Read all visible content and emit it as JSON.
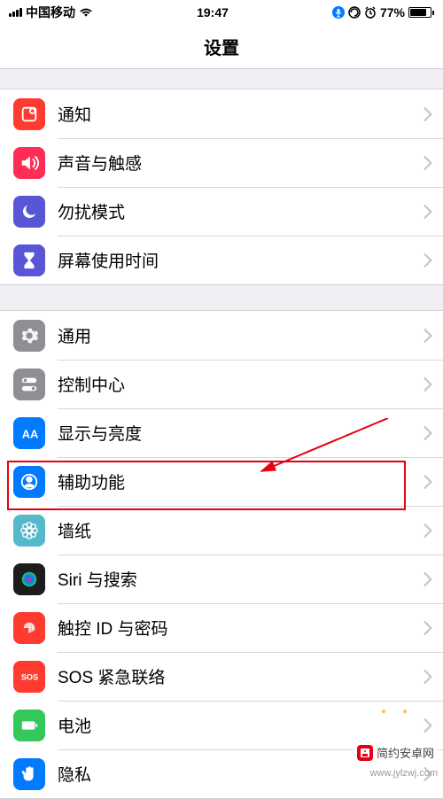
{
  "status": {
    "carrier": "中国移动",
    "time": "19:47",
    "battery_pct": "77%"
  },
  "nav": {
    "title": "设置"
  },
  "group1": [
    {
      "id": "notifications",
      "label": "通知",
      "icon_color": "#ff3b30",
      "icon": "bell"
    },
    {
      "id": "sounds",
      "label": "声音与触感",
      "icon_color": "#ff2d55",
      "icon": "speaker"
    },
    {
      "id": "dnd",
      "label": "勿扰模式",
      "icon_color": "#5856d6",
      "icon": "moon"
    },
    {
      "id": "screentime",
      "label": "屏幕使用时间",
      "icon_color": "#5856d6",
      "icon": "hourglass"
    }
  ],
  "group2": [
    {
      "id": "general",
      "label": "通用",
      "icon_color": "#8e8e93",
      "icon": "gear"
    },
    {
      "id": "control-center",
      "label": "控制中心",
      "icon_color": "#8e8e93",
      "icon": "switches"
    },
    {
      "id": "display",
      "label": "显示与亮度",
      "icon_color": "#007aff",
      "icon": "aa"
    },
    {
      "id": "accessibility",
      "label": "辅助功能",
      "icon_color": "#007aff",
      "icon": "person-circle"
    },
    {
      "id": "wallpaper",
      "label": "墙纸",
      "icon_color": "#55b9c9",
      "icon": "flower"
    },
    {
      "id": "siri",
      "label": "Siri 与搜索",
      "icon_color": "#1c1c1e",
      "icon": "siri"
    },
    {
      "id": "touchid",
      "label": "触控 ID 与密码",
      "icon_color": "#ff3b30",
      "icon": "fingerprint"
    },
    {
      "id": "sos",
      "label": "SOS 紧急联络",
      "icon_color": "#ff3b30",
      "icon": "sos"
    },
    {
      "id": "battery",
      "label": "电池",
      "icon_color": "#34c759",
      "icon": "battery"
    },
    {
      "id": "privacy",
      "label": "隐私",
      "icon_color": "#007aff",
      "icon": "hand"
    }
  ],
  "watermark": {
    "text": "简约安卓网",
    "url": "www.jylzwj.com"
  }
}
